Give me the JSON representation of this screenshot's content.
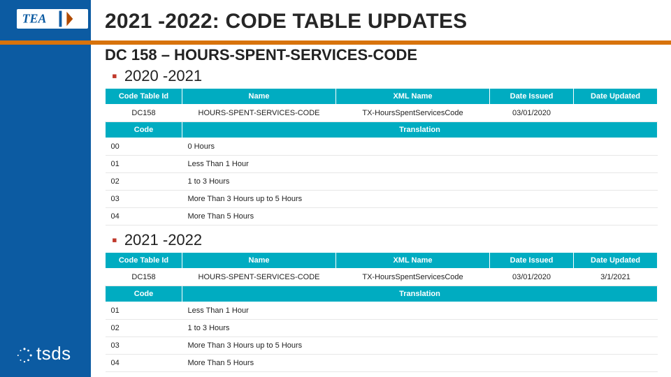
{
  "title": "2021 -2022: CODE TABLE UPDATES",
  "subtitle": "DC 158 – HOURS-SPENT-SERVICES-CODE",
  "years": {
    "y1": "2020 -2021",
    "y2": "2021 -2022"
  },
  "table1": {
    "headers": {
      "id": "Code Table Id",
      "name": "Name",
      "xml": "XML Name",
      "issued": "Date Issued",
      "updated": "Date Updated",
      "code": "Code",
      "translation": "Translation"
    },
    "info": {
      "id": "DC158",
      "name": "HOURS-SPENT-SERVICES-CODE",
      "xml": "TX-HoursSpentServicesCode",
      "issued": "03/01/2020",
      "updated": ""
    },
    "rows": [
      {
        "code": "00",
        "trans": "0 Hours"
      },
      {
        "code": "01",
        "trans": "Less Than 1 Hour"
      },
      {
        "code": "02",
        "trans": "1 to 3 Hours"
      },
      {
        "code": "03",
        "trans": "More Than 3 Hours up to 5 Hours"
      },
      {
        "code": "04",
        "trans": "More Than 5 Hours"
      }
    ]
  },
  "table2": {
    "headers": {
      "id": "Code Table Id",
      "name": "Name",
      "xml": "XML Name",
      "issued": "Date Issued",
      "updated": "Date Updated",
      "code": "Code",
      "translation": "Translation"
    },
    "info": {
      "id": "DC158",
      "name": "HOURS-SPENT-SERVICES-CODE",
      "xml": "TX-HoursSpentServicesCode",
      "issued": "03/01/2020",
      "updated": "3/1/2021"
    },
    "rows": [
      {
        "code": "01",
        "trans": "Less Than 1 Hour"
      },
      {
        "code": "02",
        "trans": "1 to 3 Hours"
      },
      {
        "code": "03",
        "trans": "More Than 3 Hours up to 5 Hours"
      },
      {
        "code": "04",
        "trans": "More Than 5 Hours"
      }
    ]
  },
  "logos": {
    "tea": "TEA",
    "tsds": "tsds"
  }
}
